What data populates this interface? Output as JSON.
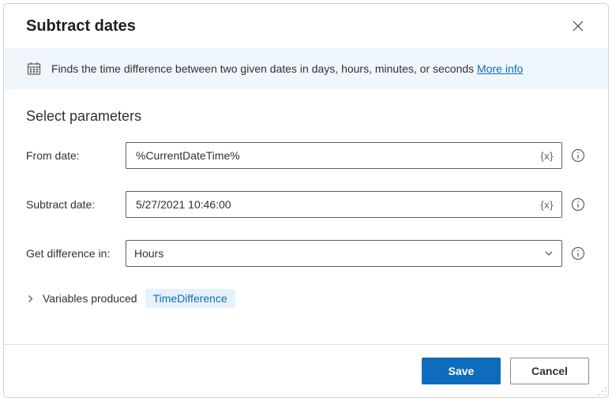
{
  "dialog": {
    "title": "Subtract dates"
  },
  "banner": {
    "text": "Finds the time difference between two given dates in days, hours, minutes, or seconds",
    "more_info": "More info"
  },
  "section": {
    "title": "Select parameters"
  },
  "fields": {
    "from_date": {
      "label": "From date:",
      "value": "%CurrentDateTime%"
    },
    "subtract_date": {
      "label": "Subtract date:",
      "value": "5/27/2021 10:46:00"
    },
    "get_diff": {
      "label": "Get difference in:",
      "value": "Hours"
    }
  },
  "variables": {
    "label": "Variables produced",
    "pill": "TimeDifference"
  },
  "buttons": {
    "save": "Save",
    "cancel": "Cancel"
  }
}
